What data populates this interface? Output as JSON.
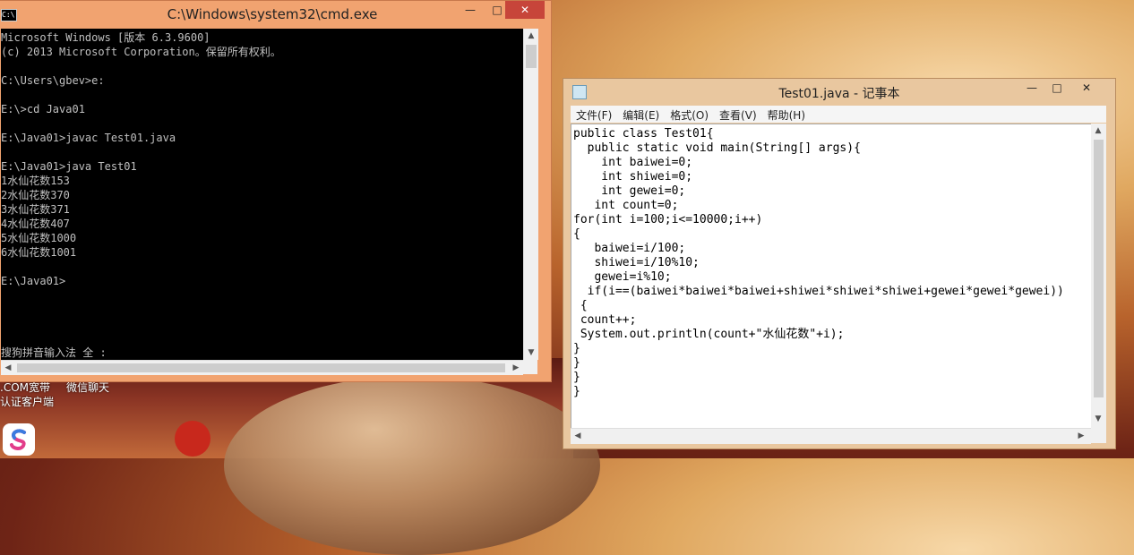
{
  "desktop": {
    "labels": [
      ".COM宽带",
      "微信聊天",
      "认证客户端"
    ]
  },
  "cmd_window": {
    "title": "C:\\Windows\\system32\\cmd.exe",
    "icon_text": "C:\\",
    "controls": {
      "minimize": "—",
      "maximize": "□",
      "close": "✕"
    },
    "output": "Microsoft Windows [版本 6.3.9600]\n(c) 2013 Microsoft Corporation。保留所有权利。\n\nC:\\Users\\gbev>e:\n\nE:\\>cd Java01\n\nE:\\Java01>javac Test01.java\n\nE:\\Java01>java Test01\n1水仙花数153\n2水仙花数370\n3水仙花数371\n4水仙花数407\n5水仙花数1000\n6水仙花数1001\n\nE:\\Java01>\n\n\n\n\n搜狗拼音输入法 全 :"
  },
  "notepad_window": {
    "title": "Test01.java - 记事本",
    "controls": {
      "minimize": "—",
      "maximize": "□",
      "close": "✕"
    },
    "menu": [
      "文件(F)",
      "编辑(E)",
      "格式(O)",
      "查看(V)",
      "帮助(H)"
    ],
    "content": "public class Test01{\n  public static void main(String[] args){\n    int baiwei=0;\n    int shiwei=0;\n    int gewei=0;\n   int count=0;\nfor(int i=100;i<=10000;i++)\n{\n   baiwei=i/100;\n   shiwei=i/10%10;\n   gewei=i%10;\n  if(i==(baiwei*baiwei*baiwei+shiwei*shiwei*shiwei+gewei*gewei*gewei))\n {\n count++;\n System.out.println(count+\"水仙花数\"+i);\n}\n}\n}\n}"
  },
  "scroll_arrows": {
    "up": "▲",
    "down": "▼",
    "left": "◀",
    "right": "▶"
  }
}
